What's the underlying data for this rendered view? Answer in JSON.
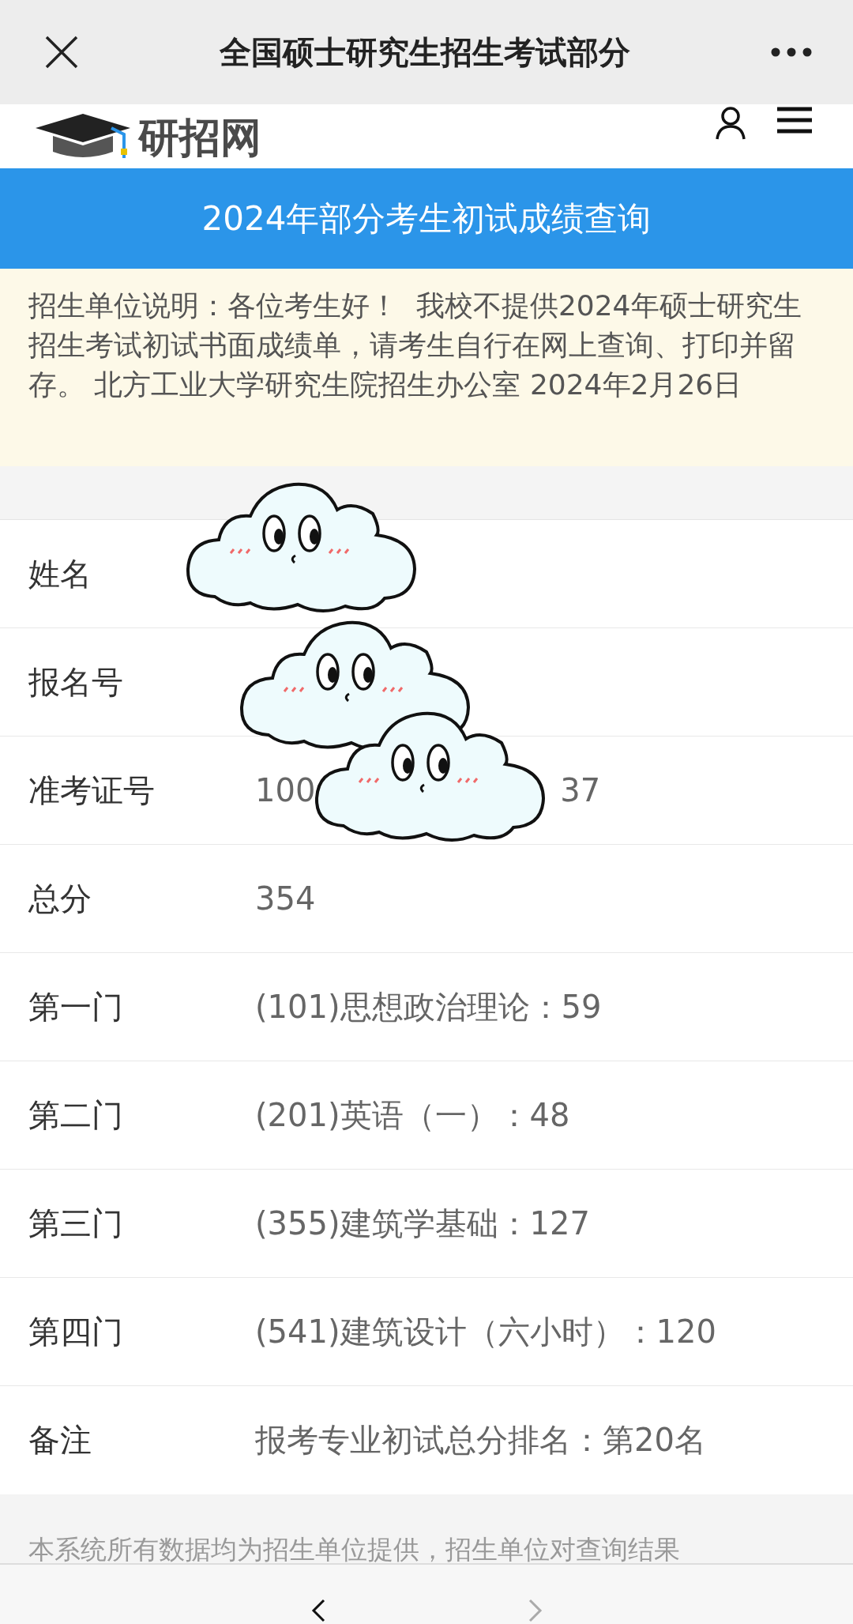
{
  "top_bar": {
    "title": "全国硕士研究生招生考试部分"
  },
  "header": {
    "logo_text": "研招网"
  },
  "banner": {
    "title": "2024年部分考生初试成绩查询"
  },
  "notice": {
    "text": "招生单位说明：各位考生好！  我校不提供2024年硕士研究生招生考试初试书面成绩单，请考生自行在网上查询、打印并留存。 北方工业大学研究生院招生办公室 2024年2月26日"
  },
  "rows": [
    {
      "label": "姓名"
    },
    {
      "label": "报名号"
    },
    {
      "label": "准考证号",
      "value_parts": [
        "100",
        "37"
      ]
    },
    {
      "label": "总分",
      "value_parts": [
        "354"
      ]
    },
    {
      "label": "第一门",
      "value_parts": [
        "(101)思想政治理论：59"
      ]
    },
    {
      "label": "第二门",
      "value_parts": [
        "(201)英语（一）：48"
      ]
    },
    {
      "label": "第三门",
      "value_parts": [
        "(355)建筑学基础：127"
      ]
    },
    {
      "label": "第四门",
      "value_parts": [
        "(541)建筑设计（六小时）：120"
      ]
    },
    {
      "label": "备注",
      "value_parts": [
        "报考专业初试总分排名：第20名"
      ]
    }
  ],
  "footer_note": {
    "text": "本系统所有数据均为招生单位提供，招生单位对查询结果"
  },
  "stickers": [
    {
      "kind": "cloud"
    },
    {
      "kind": "cloud"
    },
    {
      "kind": "cloud"
    }
  ]
}
